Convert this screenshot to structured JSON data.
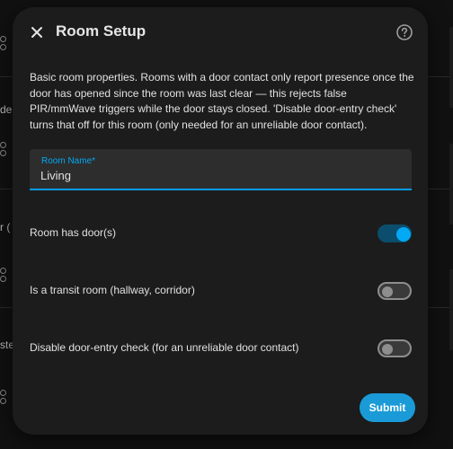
{
  "dialog": {
    "title": "Room Setup",
    "description": "Basic room properties. Rooms with a door contact only report presence once the door has opened since the room was last clear — this rejects false PIR/mmWave triggers while the door stays closed. 'Disable door-entry check' turns that off for this room (only needed for an unreliable door contact).",
    "close_icon": "close-icon",
    "help_icon": "help-circle-icon"
  },
  "room_name_field": {
    "label": "Room Name*",
    "value": "Living"
  },
  "settings": [
    {
      "label": "Room has door(s)",
      "enabled": true
    },
    {
      "label": "Is a transit room (hallway, corridor)",
      "enabled": false
    },
    {
      "label": "Disable door-entry check (for an unreliable door contact)",
      "enabled": false
    }
  ],
  "submit_label": "Submit",
  "background": {
    "fragments": [
      "de",
      "r (",
      "ste"
    ],
    "icon": "entity-icon"
  },
  "colors": {
    "accent": "#03a9f4",
    "dialog_bg": "#1c1c1c",
    "page_bg": "#111111"
  }
}
